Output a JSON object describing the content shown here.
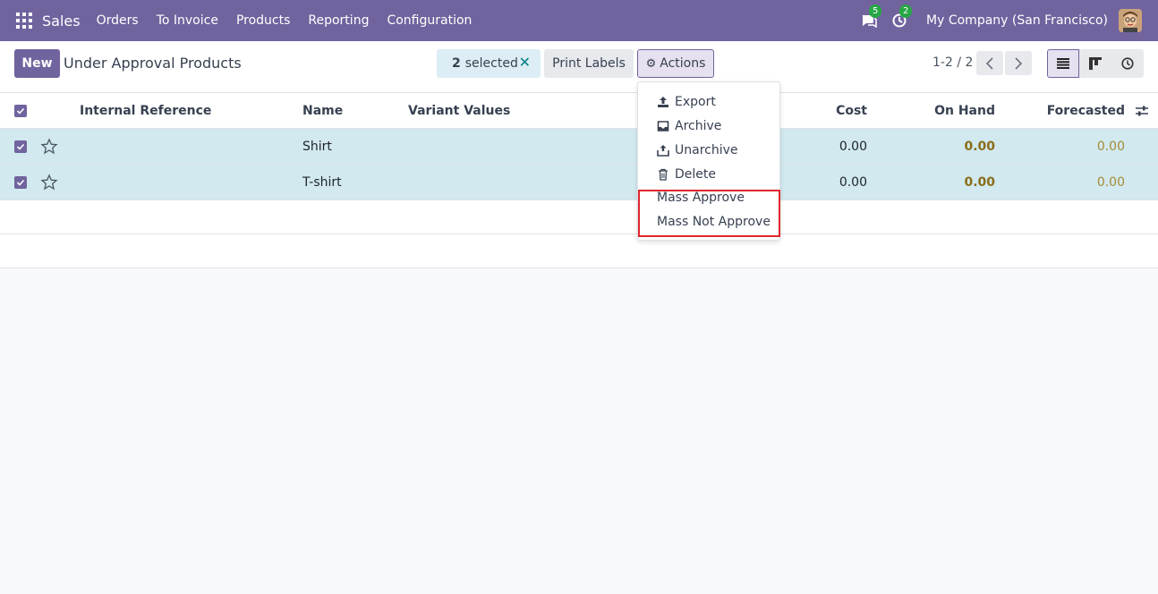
{
  "navbar": {
    "app_name": "Sales",
    "menu": [
      "Orders",
      "To Invoice",
      "Products",
      "Reporting",
      "Configuration"
    ],
    "chat_count": "5",
    "activity_count": "2",
    "company": "My Company (San Francisco)"
  },
  "control": {
    "new_label": "New",
    "title": "Under Approval Products",
    "selected_count": "2",
    "selected_label": "selected",
    "print_labels": "Print Labels",
    "actions_label": "Actions",
    "pager": "1-2 / 2"
  },
  "table": {
    "columns": {
      "internal_reference": "Internal Reference",
      "name": "Name",
      "variant_values": "Variant Values",
      "cost": "Cost",
      "on_hand": "On Hand",
      "forecasted": "Forecasted"
    },
    "rows": [
      {
        "name": "Shirt",
        "cost": "0.00",
        "on_hand": "0.00",
        "forecasted": "0.00"
      },
      {
        "name": "T-shirt",
        "cost": "0.00",
        "on_hand": "0.00",
        "forecasted": "0.00"
      }
    ]
  },
  "actions_menu": {
    "export": "Export",
    "archive": "Archive",
    "unarchive": "Unarchive",
    "delete": "Delete",
    "mass_approve": "Mass Approve",
    "mass_not_approve": "Mass Not Approve"
  },
  "colors": {
    "brand": "#71639e",
    "selected_row": "#d1e9ef",
    "highlight_box": "#e0262d"
  }
}
